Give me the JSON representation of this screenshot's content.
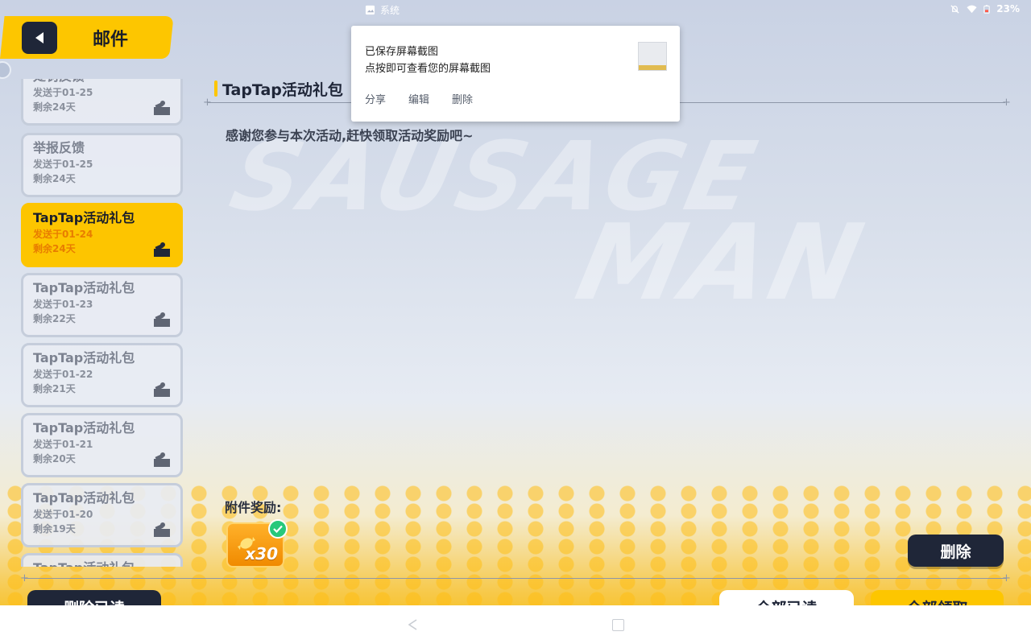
{
  "statusbar": {
    "app_label": "系统",
    "battery": "23%"
  },
  "header": {
    "title": "邮件"
  },
  "background": {
    "logo_line1": "SAUSAGE",
    "logo_line2": "MAN"
  },
  "mail_list": [
    {
      "title": "处罚反馈",
      "sent": "发送于01-25",
      "remaining": "剩余24天",
      "active": false
    },
    {
      "title": "举报反馈",
      "sent": "发送于01-25",
      "remaining": "剩余24天",
      "active": false
    },
    {
      "title": "TapTap活动礼包",
      "sent": "发送于01-24",
      "remaining": "剩余24天",
      "active": true
    },
    {
      "title": "TapTap活动礼包",
      "sent": "发送于01-23",
      "remaining": "剩余22天",
      "active": false
    },
    {
      "title": "TapTap活动礼包",
      "sent": "发送于01-22",
      "remaining": "剩余21天",
      "active": false
    },
    {
      "title": "TapTap活动礼包",
      "sent": "发送于01-21",
      "remaining": "剩余20天",
      "active": false
    },
    {
      "title": "TapTap活动礼包",
      "sent": "发送于01-20",
      "remaining": "剩余19天",
      "active": false
    },
    {
      "title": "TapTap活动礼包",
      "sent": "",
      "remaining": "",
      "active": false
    }
  ],
  "mail_detail": {
    "title": "TapTap活动礼包",
    "body": "感谢您参与本次活动,赶快领取活动奖励吧~",
    "attachment_label": "附件奖励:",
    "reward_quantity": "x30"
  },
  "buttons": {
    "delete": "删除",
    "delete_read": "删除已读",
    "mark_all_read": "全部已读",
    "claim_all": "全部领取"
  },
  "notification": {
    "line1": "已保存屏幕截图",
    "line2": "点按即可查看您的屏幕截图",
    "action_share": "分享",
    "action_edit": "编辑",
    "action_delete": "删除"
  },
  "colors": {
    "accent_yellow": "#fdc600",
    "dark_navy": "#1f2638",
    "active_sub_orange": "#e87d00",
    "claimed_green": "#27c87b"
  }
}
